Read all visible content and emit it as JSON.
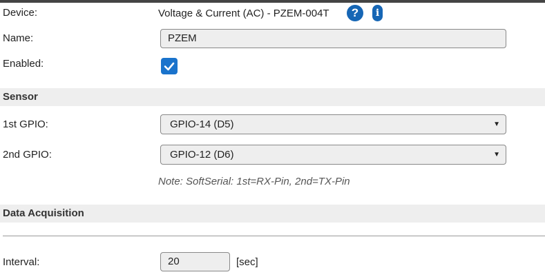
{
  "device": {
    "label": "Device:",
    "value": "Voltage & Current (AC) - PZEM-004T",
    "help_icon": "question-circle-icon",
    "info_icon": "info-icon"
  },
  "name": {
    "label": "Name:",
    "value": "PZEM"
  },
  "enabled": {
    "label": "Enabled:",
    "checked": true,
    "icon": "checkmark-icon"
  },
  "sensor": {
    "heading": "Sensor",
    "gpio1": {
      "label": "1st GPIO:",
      "selected": "GPIO-14 (D5)"
    },
    "gpio2": {
      "label": "2nd GPIO:",
      "selected": "GPIO-12 (D6)"
    },
    "note": "Note: SoftSerial: 1st=RX-Pin, 2nd=TX-Pin"
  },
  "data_acquisition": {
    "heading": "Data Acquisition",
    "interval": {
      "label": "Interval:",
      "value": "20",
      "unit": "[sec]"
    }
  },
  "colors": {
    "accent": "#1a73cc",
    "section_bg": "#eeeeee",
    "topbar": "#444444"
  }
}
